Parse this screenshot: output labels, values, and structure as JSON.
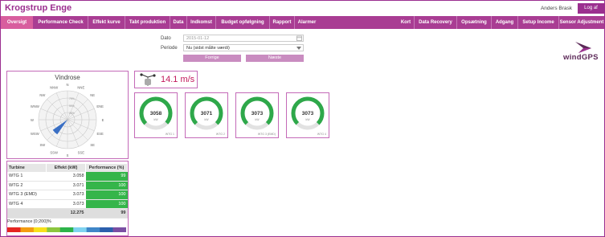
{
  "app": {
    "title": "Krogstrup Enge",
    "user": "Anders Brask",
    "logout": "Log af"
  },
  "nav": {
    "left": [
      "Oversigt",
      "Performance Check",
      "Effekt kurve",
      "Tabt produktion",
      "Data",
      "Indkomst",
      "Budget opfølgning",
      "Rapport",
      "Alarmer"
    ],
    "right": [
      "Kort",
      "Data Recovery",
      "Opsætning",
      "Adgang",
      "Setup Income",
      "Sensor Adjustment"
    ],
    "active": "Oversigt"
  },
  "filter": {
    "date_label": "Dato",
    "date_value": "2015-01-12",
    "period_label": "Periode",
    "period_value": "Nu (sidst målte værdi)",
    "prev_button": "Forrige",
    "next_button": "Næste"
  },
  "logo": {
    "text": "windGPS"
  },
  "windrose": {
    "title": "Vindrose",
    "directions": [
      "N",
      "NNE",
      "NE",
      "ENE",
      "E",
      "ESE",
      "SE",
      "SSE",
      "S",
      "SSW",
      "SW",
      "WSW",
      "W",
      "WNW",
      "NW",
      "NNW"
    ],
    "ring_labels": [
      "25%",
      "50%",
      "75%"
    ],
    "dominant_direction": "SW"
  },
  "wind": {
    "speed": "14.1 m/s"
  },
  "gauges": [
    {
      "value": "3058",
      "unit": "kW",
      "turbine": "WTG 1",
      "fraction": 0.99
    },
    {
      "value": "3071",
      "unit": "kW",
      "turbine": "WTG 2",
      "fraction": 1.0
    },
    {
      "value": "3073",
      "unit": "kW",
      "turbine": "WTG 3 (EMD)",
      "fraction": 1.0
    },
    {
      "value": "3073",
      "unit": "kW",
      "turbine": "WTG 4",
      "fraction": 1.0
    }
  ],
  "table": {
    "headers": [
      "Turbine",
      "Effekt (kW)",
      "Performance (%)"
    ],
    "rows": [
      {
        "turbine": "WTG 1",
        "effect": "3.058",
        "perf": "99"
      },
      {
        "turbine": "WTG 2",
        "effect": "3.071",
        "perf": "100"
      },
      {
        "turbine": "WTG 3 (EMD)",
        "effect": "3.073",
        "perf": "100"
      },
      {
        "turbine": "WTG 4",
        "effect": "3.073",
        "perf": "100"
      }
    ],
    "total": {
      "effect": "12.275",
      "perf": "99"
    }
  },
  "legend": {
    "label": "Performance [0;200]%",
    "colors": [
      "#e52521",
      "#f39c12",
      "#f7e11b",
      "#8cc63f",
      "#2db34a",
      "#7fd3f0",
      "#3f86c8",
      "#2b5fad",
      "#7b4fa3"
    ]
  },
  "colors": {
    "brand": "#9b2f8f",
    "nav": "#a93d93",
    "active": "#d85e9e",
    "good": "#35b54a"
  }
}
